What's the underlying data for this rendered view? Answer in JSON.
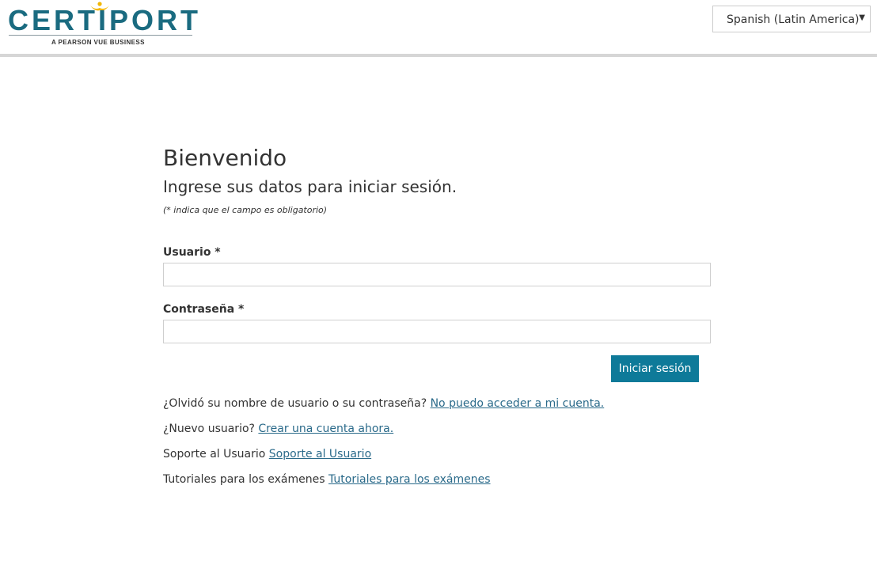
{
  "header": {
    "logo_text": "CERTIPORT",
    "logo_tagline": "A PEARSON VUE BUSINESS",
    "language_select": {
      "selected": "Spanish (Latin America)"
    }
  },
  "login": {
    "title": "Bienvenido",
    "subtitle": "Ingrese sus datos para iniciar sesión.",
    "required_note": "(* indica que el campo es obligatorio)",
    "username_label": "Usuario *",
    "username_value": "",
    "password_label": "Contraseña *",
    "password_value": "",
    "submit_label": "Iniciar sesión"
  },
  "help": {
    "forgot_text": "¿Olvidó su nombre de usuario o su contraseña?",
    "forgot_link": "No puedo acceder a mi cuenta.",
    "new_user_text": "¿Nuevo usuario?",
    "new_user_link": "Crear una cuenta ahora.",
    "support_text": "Soporte al Usuario",
    "support_link": "Soporte al Usuario",
    "tutorials_text": "Tutoriales para los exámenes",
    "tutorials_link": "Tutoriales para los exámenes"
  },
  "colors": {
    "brand_teal": "#1a6b80",
    "logo_accent_gold": "#f2b705",
    "button_bg": "#0e7a99",
    "link": "#2a6a8a",
    "header_rule": "#d6d6d6"
  },
  "icons": {
    "logo_mark": "person-figure-icon",
    "select_caret": "caret-down-icon"
  }
}
